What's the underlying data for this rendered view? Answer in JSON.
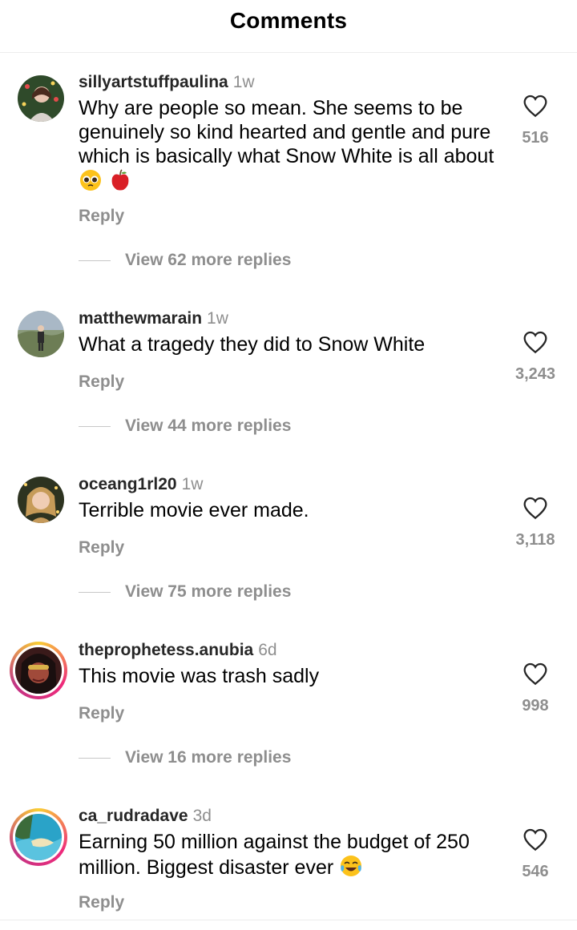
{
  "header": {
    "title": "Comments"
  },
  "comments": [
    {
      "username": "sillyartstuffpaulina",
      "time": "1w",
      "text": "Why are people so mean. She seems to be genuinely so kind hearted and gentle and pure which is basically what Snow White is all about",
      "emojis": [
        "pleading-face-emoji",
        "red-apple-emoji"
      ],
      "likes": "516",
      "reply_label": "Reply",
      "view_replies": "View 62 more replies",
      "avatar_story_ring": false
    },
    {
      "username": "matthewmarain",
      "time": "1w",
      "text": "What a tragedy they did to Snow White",
      "emojis": [],
      "likes": "3,243",
      "reply_label": "Reply",
      "view_replies": "View 44 more replies",
      "avatar_story_ring": false
    },
    {
      "username": "oceang1rl20",
      "time": "1w",
      "text": "Terrible movie ever made.",
      "emojis": [],
      "likes": "3,118",
      "reply_label": "Reply",
      "view_replies": "View 75 more replies",
      "avatar_story_ring": false
    },
    {
      "username": "theprophetess.anubia",
      "time": "6d",
      "text": "This movie was trash sadly",
      "emojis": [],
      "likes": "998",
      "reply_label": "Reply",
      "view_replies": "View 16 more replies",
      "avatar_story_ring": true
    },
    {
      "username": "ca_rudradave",
      "time": "3d",
      "text": "Earning 50 million against the budget of 250 million. Biggest disaster ever",
      "emojis": [
        "tears-of-joy-emoji"
      ],
      "likes": "546",
      "reply_label": "Reply",
      "view_replies": "",
      "avatar_story_ring": true
    }
  ],
  "icons": {
    "like": "heart-outline-icon"
  },
  "colors": {
    "secondary_text": "#8e8e8e",
    "story_ring_start": "#f9ce34",
    "story_ring_end": "#ee2a7b"
  }
}
